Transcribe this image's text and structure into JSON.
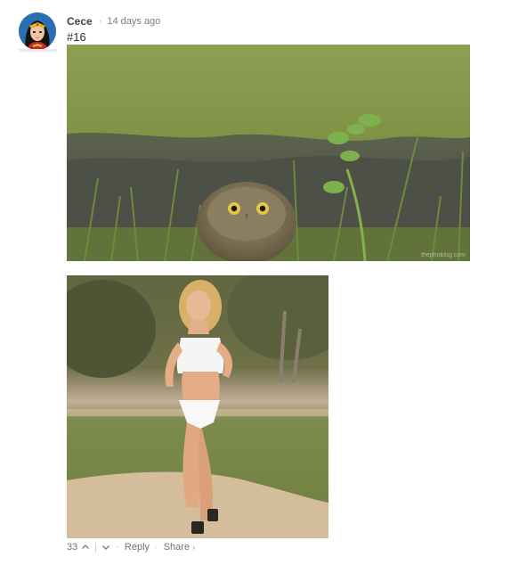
{
  "comment": {
    "author": "Cece",
    "separator": "·",
    "timestamp": "14 days ago",
    "text": "#16"
  },
  "media": [
    {
      "name": "owl-gif",
      "icon": "burrowing-owl-image"
    },
    {
      "name": "runner-gif",
      "icon": "woman-running-image"
    }
  ],
  "watermark": "thephoblog.com",
  "footer": {
    "vote_count": "33",
    "reply_label": "Reply",
    "share_label": "Share",
    "share_chevron": "›",
    "dot": "·"
  },
  "colors": {
    "author": "#3f4447",
    "meta": "#7a8186",
    "body_text": "#2a2e2e",
    "footer_text": "#6e7479"
  }
}
